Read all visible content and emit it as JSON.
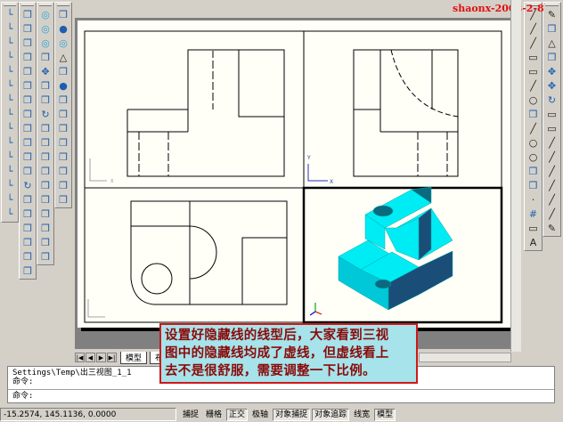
{
  "watermark": "shaonx-2008-2-8",
  "left_toolbars": [
    [
      "ucs-icon",
      "ucs-world-icon",
      "ucs-previous-icon",
      "ucs-face-icon",
      "ucs-object-icon",
      "ucs-view-icon",
      "ucs-origin-icon",
      "ucs-zaxis-icon",
      "ucs-3point-icon",
      "ucs-x-icon",
      "ucs-y-icon",
      "ucs-z-icon",
      "ucs-apply-icon",
      "named-ucs-icon",
      "ucs-move-icon"
    ],
    [
      "3d-view-icon",
      "top-view-icon",
      "bottom-view-icon",
      "left-view-icon",
      "right-view-icon",
      "front-view-icon",
      "back-view-icon",
      "sw-iso-icon",
      "se-iso-icon",
      "ne-iso-icon",
      "nw-iso-icon",
      "camera-icon",
      "3d-orbit-icon",
      "3d-pan-icon",
      "wireframe-icon",
      "hidden-icon",
      "flat-shade-icon",
      "gouraud-icon",
      "edges-icon"
    ],
    [
      "union-icon",
      "subtract-icon",
      "intersect-icon",
      "extrude-faces-icon",
      "move-faces-icon",
      "offset-faces-icon",
      "delete-faces-icon",
      "rotate-faces-icon",
      "taper-faces-icon",
      "copy-faces-icon",
      "color-faces-icon",
      "copy-edges-icon",
      "color-edges-icon",
      "imprint-icon",
      "clean-icon",
      "separate-icon",
      "shell-icon",
      "check-icon"
    ],
    [
      "box-icon",
      "sphere-icon",
      "cylinder-icon",
      "cone-icon",
      "wedge-icon",
      "torus-icon",
      "extrude-icon",
      "revolve-icon",
      "slice-icon",
      "section-icon",
      "interfere-icon",
      "setup-drawing-icon",
      "setup-view-icon",
      "setup-profile-icon"
    ]
  ],
  "right_toolbars": [
    [
      "line-icon",
      "construction-line-icon",
      "polyline-icon",
      "polygon-icon",
      "rectangle-icon",
      "arc-icon",
      "circle-icon",
      "revision-cloud-icon",
      "spline-icon",
      "ellipse-icon",
      "ellipse-arc-icon",
      "insert-block-icon",
      "make-block-icon",
      "point-icon",
      "hatch-icon",
      "region-icon",
      "mtext-icon"
    ],
    [
      "erase-icon",
      "copy-icon",
      "mirror-icon",
      "offset-icon",
      "array-icon",
      "move-icon",
      "rotate-icon",
      "scale-icon",
      "stretch-icon",
      "trim-icon",
      "extend-icon",
      "break-point-icon",
      "break-icon",
      "chamfer-icon",
      "fillet-icon",
      "explode-icon"
    ]
  ],
  "layout_tabs": {
    "model": "模型",
    "layout": "布"
  },
  "command": {
    "history_line": "Settings\\Temp\\出三视图_1_1",
    "prompt1": "命令:",
    "prompt2": "命令:"
  },
  "status": {
    "coords": "-15.2574,  145.1136,  0.0000",
    "buttons": [
      {
        "label": "捕捉",
        "on": false
      },
      {
        "label": "栅格",
        "on": false
      },
      {
        "label": "正交",
        "on": true
      },
      {
        "label": "极轴",
        "on": false
      },
      {
        "label": "对象捕捉",
        "on": true
      },
      {
        "label": "对象追踪",
        "on": true
      },
      {
        "label": "线宽",
        "on": false
      },
      {
        "label": "模型",
        "on": true
      }
    ]
  },
  "callout": {
    "lines": [
      "设置好隐藏线的线型后，大家看到三视",
      "图中的隐藏线均成了虚线，但虚线看上",
      "去不是很舒服，需要调整一下比例。"
    ]
  },
  "colors": {
    "solid_top": "#00ecf4",
    "solid_side": "#1a4e78",
    "callout_border": "#d01818",
    "callout_bg": "#a6e3ea",
    "watermark": "#e01010"
  },
  "ucs_labels": {
    "x": "X",
    "y": "Y"
  }
}
